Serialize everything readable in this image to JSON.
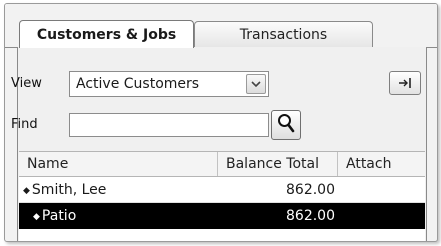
{
  "tabs": [
    {
      "label": "Customers & Jobs",
      "active": true
    },
    {
      "label": "Transactions",
      "active": false
    }
  ],
  "view": {
    "label": "View",
    "selected": "Active Customers"
  },
  "find": {
    "label": "Find",
    "value": "",
    "placeholder": ""
  },
  "table": {
    "columns": [
      "Name",
      "Balance Total",
      "Attach"
    ],
    "rows": [
      {
        "name": "Smith, Lee",
        "balance": "862.00",
        "attach": "",
        "selected": false,
        "indent": 0
      },
      {
        "name": "Patio",
        "balance": "862.00",
        "attach": "",
        "selected": true,
        "indent": 1
      }
    ]
  },
  "colors": {
    "selected_row": "#000000",
    "panel_bg": "#f0f0f0"
  }
}
